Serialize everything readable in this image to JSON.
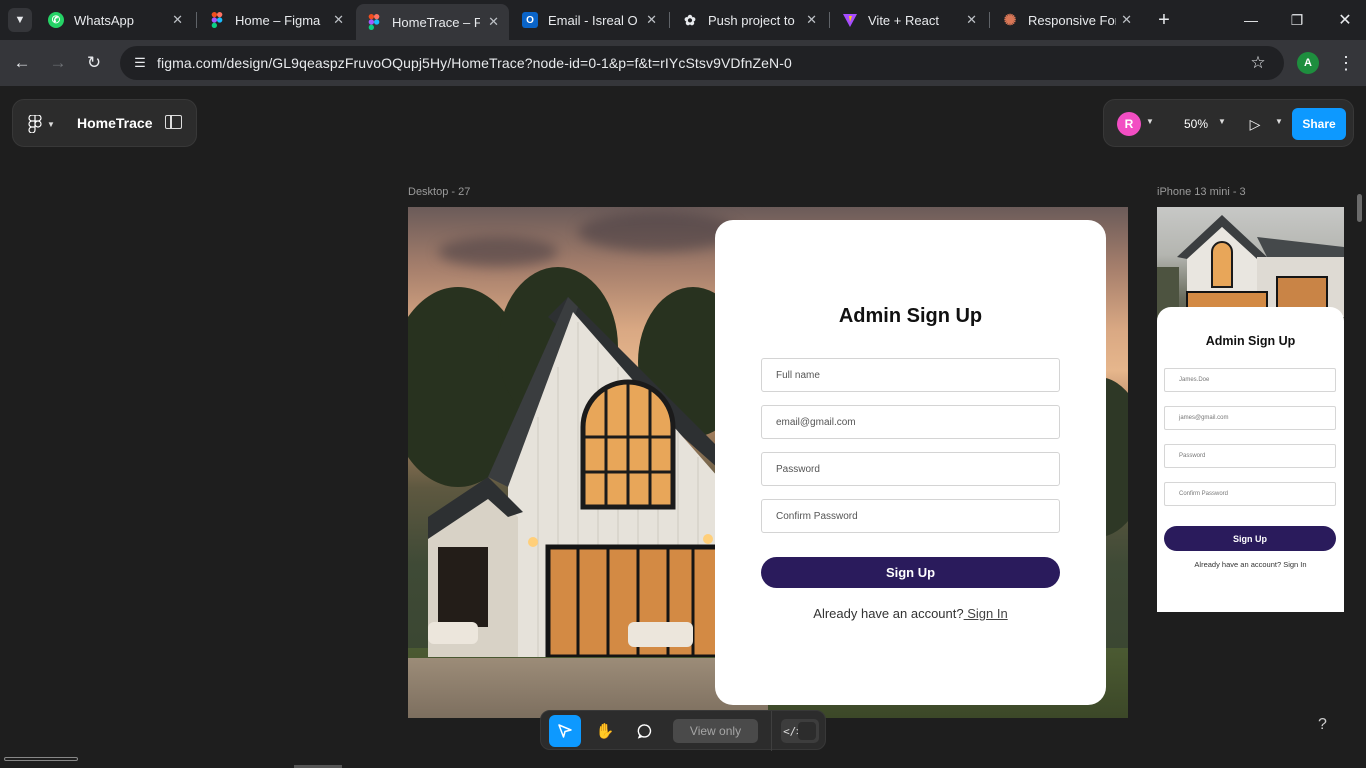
{
  "browser": {
    "tabs": [
      {
        "title": "WhatsApp",
        "icon": "whatsapp-icon",
        "color": "#25d366",
        "active": false
      },
      {
        "title": "Home – Figma",
        "icon": "figma-icon",
        "color": "#f24e1e",
        "active": false
      },
      {
        "title": "HomeTrace – Fig",
        "icon": "figma-icon",
        "color": "#f24e1e",
        "active": true
      },
      {
        "title": "Email - Isreal Ok",
        "icon": "outlook-icon",
        "color": "#0a64c8",
        "active": false
      },
      {
        "title": "Push project to G",
        "icon": "chatgpt-icon",
        "color": "#e8eaed",
        "active": false
      },
      {
        "title": "Vite + React",
        "icon": "vite-icon",
        "color": "#a64dff",
        "active": false
      },
      {
        "title": "Responsive Form",
        "icon": "claude-icon",
        "color": "#d97757",
        "active": false
      }
    ],
    "url": "figma.com/design/GL9qeaspzFruvoOQupj5Hy/HomeTrace?node-id=0-1&p=f&t=rIYcStsv9VDfnZeN-0",
    "profile_initial": "A"
  },
  "figma": {
    "file_name": "HomeTrace",
    "collaborator_initial": "R",
    "zoom": "50%",
    "share_label": "Share",
    "view_only_label": "View only"
  },
  "desktop_frame": {
    "label": "Desktop - 27",
    "title": "Admin Sign Up",
    "fields": [
      "Full name",
      "email@gmail.com",
      "Password",
      "Confirm Password"
    ],
    "button": "Sign Up",
    "already_text": "Already have an account?",
    "sign_in_link": " Sign In"
  },
  "mobile_frame": {
    "label": "iPhone 13 mini - 3",
    "title": "Admin Sign Up",
    "fields": [
      "James.Doe",
      "james@gmail.com",
      "Password",
      "Confirm Password"
    ],
    "button": "Sign Up",
    "already_text": "Already have an account? Sign In"
  },
  "colors": {
    "figma_blue": "#0d99ff",
    "button_purple": "#2a1b5c",
    "collaborator_pink": "#f24ec3"
  }
}
